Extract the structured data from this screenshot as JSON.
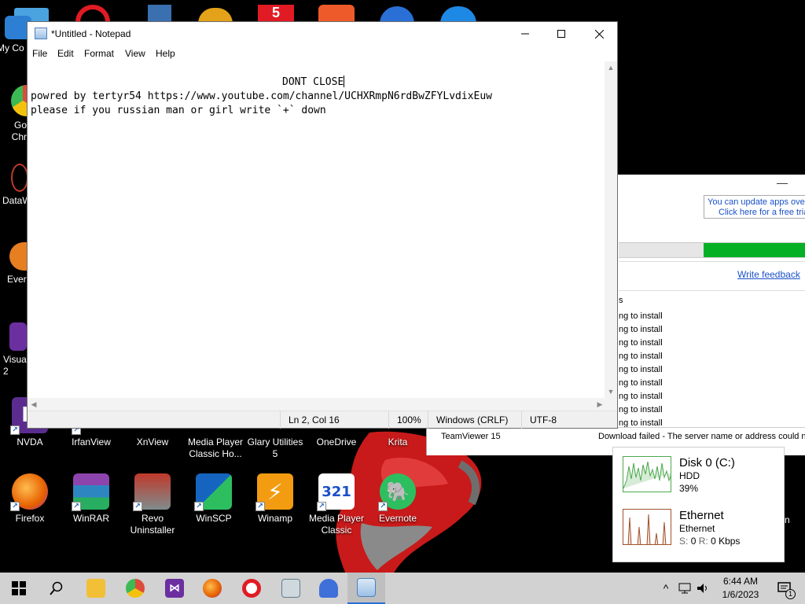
{
  "notepad": {
    "title": "*Untitled - Notepad",
    "menu": [
      "File",
      "Edit",
      "Format",
      "View",
      "Help"
    ],
    "lines": [
      "DONT CLOSE",
      "powred by tertyr54 https://www.youtube.com/channel/UCHXRmpN6rdBwZFYLvdixEuw",
      "please if you russian man or girl write `+` down"
    ],
    "status": {
      "position": "Ln 2, Col 16",
      "zoom": "100%",
      "line_ending": "Windows (CRLF)",
      "encoding": "UTF-8"
    }
  },
  "desktop_icons_top": [
    {
      "label": "My Co",
      "name": "my-computer-icon",
      "color": "#2d7fd3"
    },
    {
      "label": "Go Chr",
      "name": "google-chrome-icon",
      "color": "#dd4b39"
    },
    {
      "label": "DataW",
      "name": "datawrapper-icon",
      "color": "#c0392b"
    },
    {
      "label": "Ever",
      "name": "everything-icon",
      "color": "#e67e22"
    },
    {
      "label": "Visua 2",
      "name": "visual-studio-icon",
      "color": "#6b2fa0"
    }
  ],
  "desktop_icons_row1": [
    {
      "label": "NVDA",
      "name": "nvda-icon",
      "color": "#5b2c8f"
    },
    {
      "label": "IrfanView",
      "name": "irfanview-icon",
      "color": "#c0392b"
    },
    {
      "label": "XnView",
      "name": "xnview-icon",
      "color": "#2e86c1"
    },
    {
      "label": "Media Player Classic Ho...",
      "name": "media-player-classic-ho-icon",
      "color": "#34495e"
    },
    {
      "label": "Glary Utilities 5",
      "name": "glary-utilities-icon",
      "color": "#2874a6"
    },
    {
      "label": "OneDrive",
      "name": "onedrive-icon",
      "color": "#1e88e5"
    },
    {
      "label": "Krita",
      "name": "krita-icon",
      "color": "#3d85c6"
    }
  ],
  "desktop_icons_row2": [
    {
      "label": "Firefox",
      "name": "firefox-icon",
      "color": "#e66000",
      "glyph": "🦊"
    },
    {
      "label": "WinRAR",
      "name": "winrar-icon",
      "color": "#8e44ad",
      "glyph": "▤"
    },
    {
      "label": "Revo Uninstaller",
      "name": "revo-uninstaller-icon",
      "color": "#7f8c8d",
      "glyph": "◆"
    },
    {
      "label": "WinSCP",
      "name": "winscp-icon",
      "color": "#1565c0",
      "glyph": "⇄"
    },
    {
      "label": "Winamp",
      "name": "winamp-icon",
      "color": "#f39c12",
      "glyph": "⚡"
    },
    {
      "label": "Media Player Classic",
      "name": "media-player-classic-icon",
      "color": "#2c3e50",
      "glyph": "321"
    },
    {
      "label": "Evernote",
      "name": "evernote-icon",
      "color": "#2dbe60",
      "glyph": "🐘"
    }
  ],
  "top_shortcuts": [
    "recycle-bin",
    "opera",
    "screenshot",
    "chrome",
    "5",
    "paint",
    "teamviewer",
    "cloud"
  ],
  "update_window": {
    "notice_line1": "You can update apps over",
    "notice_line2": "Click here for a free trial",
    "progress": 0.57,
    "feedback": "Write feedback",
    "header": "s",
    "rows": [
      "ng to install",
      "ng to install",
      "ng to install",
      "ng to install",
      "ng to install",
      "ng to install",
      "ng to install",
      "ng to install",
      "ng to install"
    ],
    "teamviewer_name": "TeamViewer 15",
    "teamviewer_status": "Download failed - The server name or address could no"
  },
  "perf": {
    "disk_title": "Disk 0 (C:)",
    "disk_type": "HDD",
    "disk_pct": "39%",
    "eth_title": "Ethernet",
    "eth_sub": "Ethernet",
    "eth_rate_s": "S:",
    "eth_rate_s_val": "0",
    "eth_rate_r": "R:",
    "eth_rate_r_val": "0 Kbps",
    "edge_letter": "n"
  },
  "taskbar": {
    "time": "6:44 AM",
    "date": "1/6/2023",
    "notif_count": "1"
  },
  "colors": {
    "progress_green": "#06b025",
    "link_blue": "#1a50c8",
    "taskbar": "#d2d2d2"
  }
}
